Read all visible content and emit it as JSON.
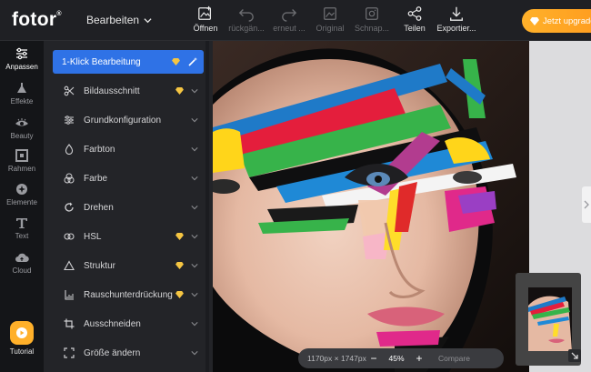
{
  "brand": {
    "logo": "fotor",
    "logo_mark": "®"
  },
  "header": {
    "menu_label": "Bearbeiten",
    "toolbar": [
      {
        "label": "Öffnen",
        "icon": "image-add-icon",
        "enabled": true
      },
      {
        "label": "rückgän...",
        "icon": "undo-icon",
        "enabled": false
      },
      {
        "label": "erneut ...",
        "icon": "redo-icon",
        "enabled": false
      },
      {
        "label": "Original",
        "icon": "original-image-icon",
        "enabled": false
      },
      {
        "label": "Schnap...",
        "icon": "snapshot-icon",
        "enabled": false
      },
      {
        "label": "Teilen",
        "icon": "share-icon",
        "enabled": true
      },
      {
        "label": "Exportier...",
        "icon": "download-icon",
        "enabled": true
      }
    ],
    "upgrade_label": "Jetzt upgrade"
  },
  "rail": {
    "items": [
      {
        "label": "Anpassen",
        "icon": "sliders-icon",
        "active": true
      },
      {
        "label": "Effekte",
        "icon": "flask-icon",
        "active": false
      },
      {
        "label": "Beauty",
        "icon": "eye-icon",
        "active": false
      },
      {
        "label": "Rahmen",
        "icon": "frame-icon",
        "active": false
      },
      {
        "label": "Elemente",
        "icon": "elements-icon",
        "active": false
      },
      {
        "label": "Text",
        "icon": "text-icon",
        "active": false
      },
      {
        "label": "Cloud",
        "icon": "cloud-icon",
        "active": false
      }
    ],
    "tutorial_label": "Tutorial"
  },
  "panel": {
    "items": [
      {
        "label": "1-Klick Bearbeitung",
        "icon": "magic-wand-icon",
        "premium": true,
        "selected": true
      },
      {
        "label": "Bildausschnitt",
        "icon": "scissors-icon",
        "premium": true,
        "selected": false
      },
      {
        "label": "Grundkonfiguration",
        "icon": "adjust-icon",
        "premium": false,
        "selected": false
      },
      {
        "label": "Farbton",
        "icon": "drop-icon",
        "premium": false,
        "selected": false
      },
      {
        "label": "Farbe",
        "icon": "color-circles-icon",
        "premium": false,
        "selected": false
      },
      {
        "label": "Drehen",
        "icon": "rotate-icon",
        "premium": false,
        "selected": false
      },
      {
        "label": "HSL",
        "icon": "hsl-icon",
        "premium": true,
        "selected": false
      },
      {
        "label": "Struktur",
        "icon": "triangle-icon",
        "premium": true,
        "selected": false
      },
      {
        "label": "Rauschunterdrückung",
        "icon": "noise-icon",
        "premium": true,
        "selected": false
      },
      {
        "label": "Ausschneiden",
        "icon": "crop-icon",
        "premium": false,
        "selected": false
      },
      {
        "label": "Größe ändern",
        "icon": "resize-icon",
        "premium": false,
        "selected": false
      }
    ]
  },
  "canvas": {
    "dimensions": "1170px × 1747px",
    "zoom_minus": "−",
    "zoom": "45%",
    "zoom_plus": "+",
    "compare": "Compare"
  },
  "colors": {
    "accent": "#2f72e6",
    "upgrade": "#ffb12a",
    "premium_diamond": "#f5c542"
  }
}
